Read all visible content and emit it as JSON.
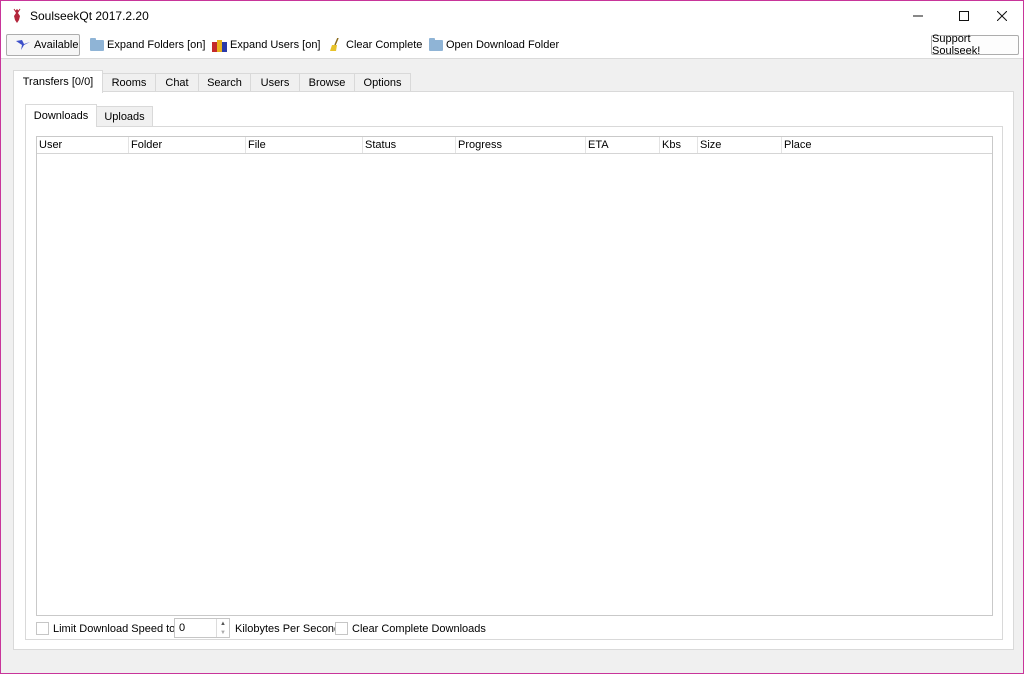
{
  "window": {
    "title": "SoulseekQt 2017.2.20",
    "controls": {
      "minimize": "minimize",
      "maximize": "maximize",
      "close": "close"
    }
  },
  "toolbar": {
    "status_button": {
      "label": "Available",
      "icon": "bird-icon"
    },
    "items": [
      {
        "label": "Expand Folders [on]",
        "icon": "folder-icon"
      },
      {
        "label": "Expand Users [on]",
        "icon": "users-icon"
      },
      {
        "label": "Clear Complete",
        "icon": "broom-icon"
      },
      {
        "label": "Open Download Folder",
        "icon": "folder-icon"
      }
    ],
    "support_button": "Support Soulseek!"
  },
  "main_tabs": [
    {
      "label": "Transfers [0/0]",
      "active": true
    },
    {
      "label": "Rooms",
      "active": false
    },
    {
      "label": "Chat",
      "active": false
    },
    {
      "label": "Search",
      "active": false
    },
    {
      "label": "Users",
      "active": false
    },
    {
      "label": "Browse",
      "active": false
    },
    {
      "label": "Options",
      "active": false
    }
  ],
  "sub_tabs": [
    {
      "label": "Downloads",
      "active": true
    },
    {
      "label": "Uploads",
      "active": false
    }
  ],
  "table": {
    "columns": [
      "User",
      "Folder",
      "File",
      "Status",
      "Progress",
      "ETA",
      "Kbs",
      "Size",
      "Place"
    ],
    "rows": []
  },
  "bottom": {
    "limit_speed_label": "Limit Download Speed to",
    "limit_speed_checked": false,
    "speed_value": "0",
    "speed_unit": "Kilobytes Per Second",
    "clear_complete_label": "Clear Complete Downloads",
    "clear_complete_checked": false
  }
}
